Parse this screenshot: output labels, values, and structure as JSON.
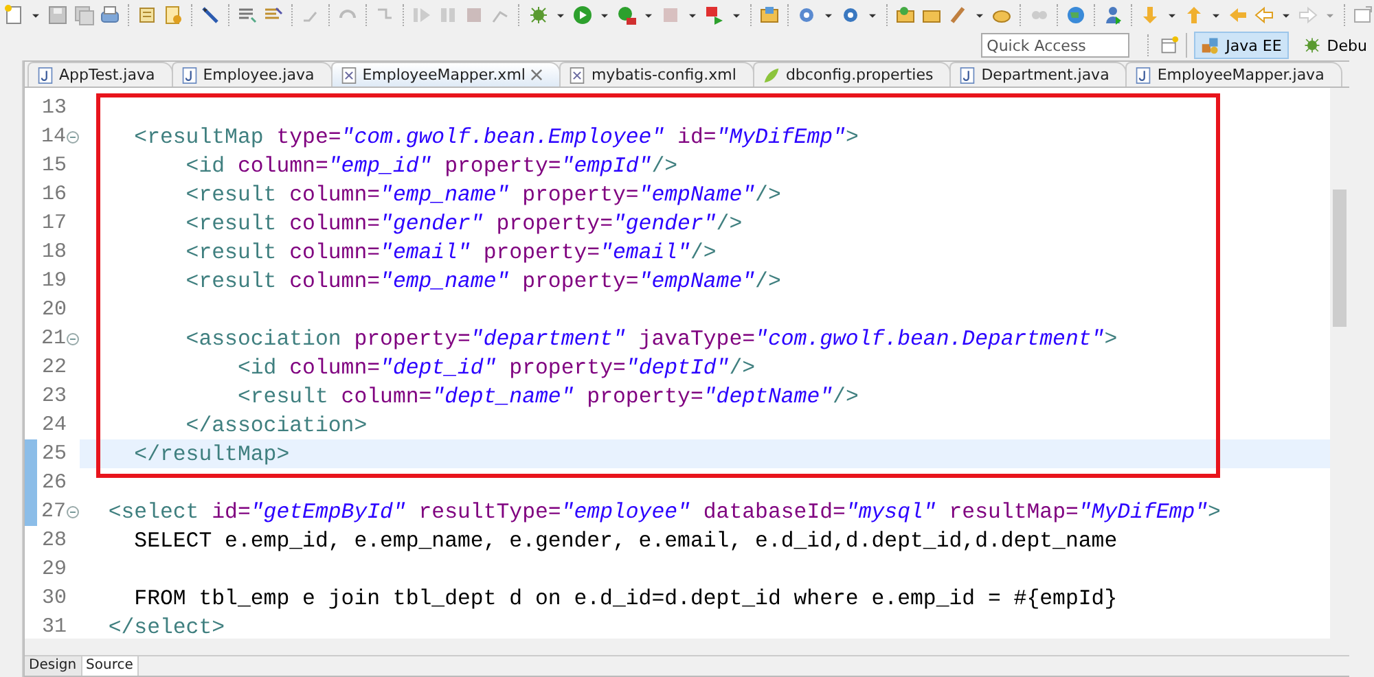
{
  "toolbar": {
    "quick_access": {
      "placeholder": "Quick Access"
    },
    "perspectives": [
      {
        "label": "Java EE",
        "kind": "javaee",
        "selected": true
      },
      {
        "label": "Debu",
        "kind": "debug",
        "selected": false
      }
    ]
  },
  "tabs": [
    {
      "label": "AppTest.java",
      "kind": "java",
      "selected": false
    },
    {
      "label": "Employee.java",
      "kind": "java",
      "selected": false
    },
    {
      "label": "EmployeeMapper.xml",
      "kind": "xml",
      "selected": true
    },
    {
      "label": "mybatis-config.xml",
      "kind": "xml",
      "selected": false
    },
    {
      "label": "dbconfig.properties",
      "kind": "properties",
      "selected": false
    },
    {
      "label": "Department.java",
      "kind": "java",
      "selected": false
    },
    {
      "label": "EmployeeMapper.java",
      "kind": "java",
      "selected": false
    }
  ],
  "editor": {
    "annotation": {
      "kind": "rectangle"
    },
    "lines": [
      {
        "number": "13",
        "foldable": false,
        "current": false,
        "changed": false
      },
      {
        "number": "14",
        "foldable": true,
        "current": false,
        "changed": false,
        "tokens": [
          {
            "kind": "tag",
            "text": "    <resultMap"
          },
          {
            "kind": "attr",
            "text": " type="
          },
          {
            "kind": "value",
            "text": "\"com.gwolf.bean.Employee\""
          },
          {
            "kind": "attr",
            "text": " id="
          },
          {
            "kind": "value",
            "text": "\"MyDifEmp\""
          },
          {
            "kind": "tag",
            "text": ">"
          }
        ]
      },
      {
        "number": "15",
        "foldable": false,
        "current": false,
        "changed": false,
        "tokens": [
          {
            "kind": "tag",
            "text": "        <id"
          },
          {
            "kind": "attr",
            "text": " column="
          },
          {
            "kind": "value",
            "text": "\"emp_id\""
          },
          {
            "kind": "attr",
            "text": " property="
          },
          {
            "kind": "value",
            "text": "\"empId\""
          },
          {
            "kind": "tag",
            "text": "/>"
          }
        ]
      },
      {
        "number": "16",
        "foldable": false,
        "current": false,
        "changed": false,
        "tokens": [
          {
            "kind": "tag",
            "text": "        <result"
          },
          {
            "kind": "attr",
            "text": " column="
          },
          {
            "kind": "value",
            "text": "\"emp_name\""
          },
          {
            "kind": "attr",
            "text": " property="
          },
          {
            "kind": "value",
            "text": "\"empName\""
          },
          {
            "kind": "tag",
            "text": "/>"
          }
        ]
      },
      {
        "number": "17",
        "foldable": false,
        "current": false,
        "changed": false,
        "tokens": [
          {
            "kind": "tag",
            "text": "        <result"
          },
          {
            "kind": "attr",
            "text": " column="
          },
          {
            "kind": "value",
            "text": "\"gender\""
          },
          {
            "kind": "attr",
            "text": " property="
          },
          {
            "kind": "value",
            "text": "\"gender\""
          },
          {
            "kind": "tag",
            "text": "/>"
          }
        ]
      },
      {
        "number": "18",
        "foldable": false,
        "current": false,
        "changed": false,
        "tokens": [
          {
            "kind": "tag",
            "text": "        <result"
          },
          {
            "kind": "attr",
            "text": " column="
          },
          {
            "kind": "value",
            "text": "\"email\""
          },
          {
            "kind": "attr",
            "text": " property="
          },
          {
            "kind": "value",
            "text": "\"email\""
          },
          {
            "kind": "tag",
            "text": "/>"
          }
        ]
      },
      {
        "number": "19",
        "foldable": false,
        "current": false,
        "changed": false,
        "tokens": [
          {
            "kind": "tag",
            "text": "        <result"
          },
          {
            "kind": "attr",
            "text": " column="
          },
          {
            "kind": "value",
            "text": "\"emp_name\""
          },
          {
            "kind": "attr",
            "text": " property="
          },
          {
            "kind": "value",
            "text": "\"empName\""
          },
          {
            "kind": "tag",
            "text": "/>"
          }
        ]
      },
      {
        "number": "20",
        "foldable": false,
        "current": false,
        "changed": false
      },
      {
        "number": "21",
        "foldable": true,
        "current": false,
        "changed": false,
        "tokens": [
          {
            "kind": "tag",
            "text": "        <association"
          },
          {
            "kind": "attr",
            "text": " property="
          },
          {
            "kind": "value",
            "text": "\"department\""
          },
          {
            "kind": "attr",
            "text": " javaType="
          },
          {
            "kind": "value",
            "text": "\"com.gwolf.bean.Department\""
          },
          {
            "kind": "tag",
            "text": ">"
          }
        ]
      },
      {
        "number": "22",
        "foldable": false,
        "current": false,
        "changed": false,
        "tokens": [
          {
            "kind": "tag",
            "text": "            <id"
          },
          {
            "kind": "attr",
            "text": " column="
          },
          {
            "kind": "value",
            "text": "\"dept_id\""
          },
          {
            "kind": "attr",
            "text": " property="
          },
          {
            "kind": "value",
            "text": "\"deptId\""
          },
          {
            "kind": "tag",
            "text": "/>"
          }
        ]
      },
      {
        "number": "23",
        "foldable": false,
        "current": false,
        "changed": false,
        "tokens": [
          {
            "kind": "tag",
            "text": "            <result"
          },
          {
            "kind": "attr",
            "text": " column="
          },
          {
            "kind": "value",
            "text": "\"dept_name\""
          },
          {
            "kind": "attr",
            "text": " property="
          },
          {
            "kind": "value",
            "text": "\"deptName\""
          },
          {
            "kind": "tag",
            "text": "/>"
          }
        ]
      },
      {
        "number": "24",
        "foldable": false,
        "current": false,
        "changed": false,
        "tokens": [
          {
            "kind": "tag",
            "text": "        </association>"
          }
        ]
      },
      {
        "number": "25",
        "foldable": false,
        "current": true,
        "changed": true,
        "tokens": [
          {
            "kind": "tag",
            "text": "    </resultMap>"
          }
        ]
      },
      {
        "number": "26",
        "foldable": false,
        "current": false,
        "changed": true
      },
      {
        "number": "27",
        "foldable": true,
        "current": false,
        "changed": true,
        "tokens": [
          {
            "kind": "tag",
            "text": "  <select"
          },
          {
            "kind": "attr",
            "text": " id="
          },
          {
            "kind": "value",
            "text": "\"getEmpById\""
          },
          {
            "kind": "attr",
            "text": " resultType="
          },
          {
            "kind": "value",
            "text": "\"employee\""
          },
          {
            "kind": "attr",
            "text": " databaseId="
          },
          {
            "kind": "value",
            "text": "\"mysql\""
          },
          {
            "kind": "attr",
            "text": " resultMap="
          },
          {
            "kind": "value",
            "text": "\"MyDifEmp\""
          },
          {
            "kind": "tag",
            "text": ">"
          }
        ]
      },
      {
        "number": "28",
        "foldable": false,
        "current": false,
        "changed": false,
        "tokens": [
          {
            "kind": "text",
            "text": "    SELECT e.emp_id, e.emp_name, e.gender, e.email, e.d_id,d.dept_id,d.dept_name"
          }
        ]
      },
      {
        "number": "29",
        "foldable": false,
        "current": false,
        "changed": false
      },
      {
        "number": "30",
        "foldable": false,
        "current": false,
        "changed": false,
        "tokens": [
          {
            "kind": "text",
            "text": "    FROM tbl_emp e join tbl_dept d on e.d_id=d.dept_id where e.emp_id = #{empId}"
          }
        ]
      },
      {
        "number": "31",
        "foldable": false,
        "current": false,
        "changed": false,
        "tokens": [
          {
            "kind": "tag",
            "text": "  </select>"
          }
        ]
      }
    ]
  },
  "bottom_tabs": [
    {
      "label": "Design",
      "selected": false
    },
    {
      "label": "Source",
      "selected": true
    }
  ]
}
